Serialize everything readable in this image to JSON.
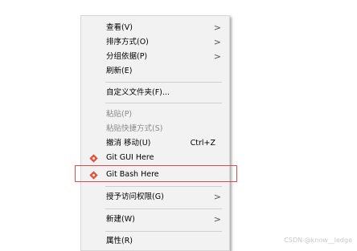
{
  "context_menu": {
    "items": [
      {
        "label": "查看(V)",
        "submenu": true
      },
      {
        "label": "排序方式(O)",
        "submenu": true
      },
      {
        "label": "分组依据(P)",
        "submenu": true
      },
      {
        "label": "刷新(E)"
      },
      {
        "label": "自定义文件夹(F)..."
      },
      {
        "label": "粘贴(P)",
        "disabled": true
      },
      {
        "label": "粘贴快捷方式(S)",
        "disabled": true
      },
      {
        "label": "撤消 移动(U)",
        "shortcut": "Ctrl+Z"
      },
      {
        "label": "Git GUI Here",
        "icon": "git-icon"
      },
      {
        "label": "Git Bash Here",
        "icon": "git-icon"
      },
      {
        "label": "授予访问权限(G)",
        "submenu": true
      },
      {
        "label": "新建(W)",
        "submenu": true
      },
      {
        "label": "属性(R)"
      }
    ],
    "submenu_arrow": ">"
  },
  "watermark": "CSDN @know__ledge",
  "colors": {
    "menu_bg": "#f2f2f2",
    "highlight_border": "#e04a4a",
    "git_icon": "#e8523a"
  }
}
